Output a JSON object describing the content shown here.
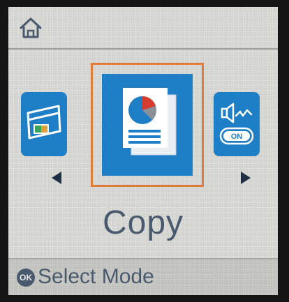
{
  "topbar": {
    "home_icon": "home-icon"
  },
  "modes": {
    "previous": {
      "icon": "scanner-icon"
    },
    "current": {
      "icon": "copy-document-icon",
      "label": "Copy"
    },
    "next": {
      "icon": "speaker-sound-icon",
      "badge": "ON"
    }
  },
  "nav": {
    "left_icon": "left-arrow-icon",
    "right_icon": "right-arrow-icon"
  },
  "footer": {
    "ok_label": "OK",
    "hint": "Select Mode"
  },
  "colors": {
    "tile_blue": "#1f7fc6",
    "selection_orange": "#e07b3c",
    "text_slate": "#4a5a6e",
    "pie_red": "#d63b2f"
  }
}
